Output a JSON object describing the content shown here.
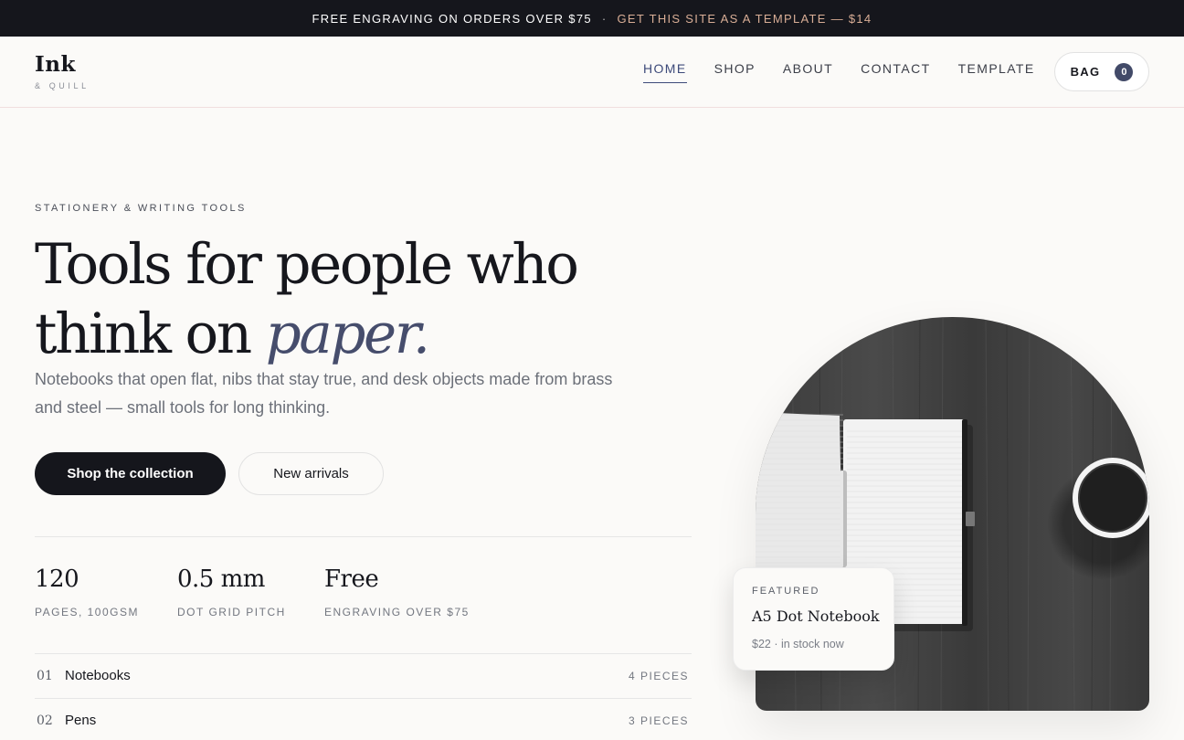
{
  "announcement": {
    "text": "FREE ENGRAVING ON ORDERS OVER $75",
    "separator": "·",
    "promo": "GET THIS SITE AS A TEMPLATE — $14"
  },
  "brand": {
    "name": "Ink",
    "tagline": "& QUILL"
  },
  "nav": {
    "items": [
      {
        "label": "HOME",
        "active": true
      },
      {
        "label": "SHOP"
      },
      {
        "label": "ABOUT"
      },
      {
        "label": "CONTACT"
      },
      {
        "label": "TEMPLATE"
      }
    ],
    "bag_label": "BAG",
    "bag_count": "0"
  },
  "hero": {
    "eyebrow": "STATIONERY & WRITING TOOLS",
    "headline_main": "Tools for people who think on ",
    "headline_emphasis": "paper.",
    "lede": "Notebooks that open flat, nibs that stay true, and desk objects made from brass and steel — small tools for long thinking.",
    "primary_cta": "Shop the collection",
    "secondary_cta": "New arrivals"
  },
  "stats": [
    {
      "value": "120",
      "label": "PAGES, 100GSM"
    },
    {
      "value": "0.5 mm",
      "label": "DOT GRID PITCH"
    },
    {
      "value": "Free",
      "label": "ENGRAVING OVER $75"
    }
  ],
  "categories": [
    {
      "num": "01",
      "name": "Notebooks",
      "count": "4 PIECES"
    },
    {
      "num": "02",
      "name": "Pens",
      "count": "3 PIECES"
    }
  ],
  "featured": {
    "tag": "FEATURED",
    "name": "A5 Dot Notebook",
    "meta": "$22 · in stock now"
  },
  "colors": {
    "ink": "#16171d",
    "accent": "#464d6c",
    "promo": "#d9ae96",
    "background": "#fbfaf8"
  }
}
